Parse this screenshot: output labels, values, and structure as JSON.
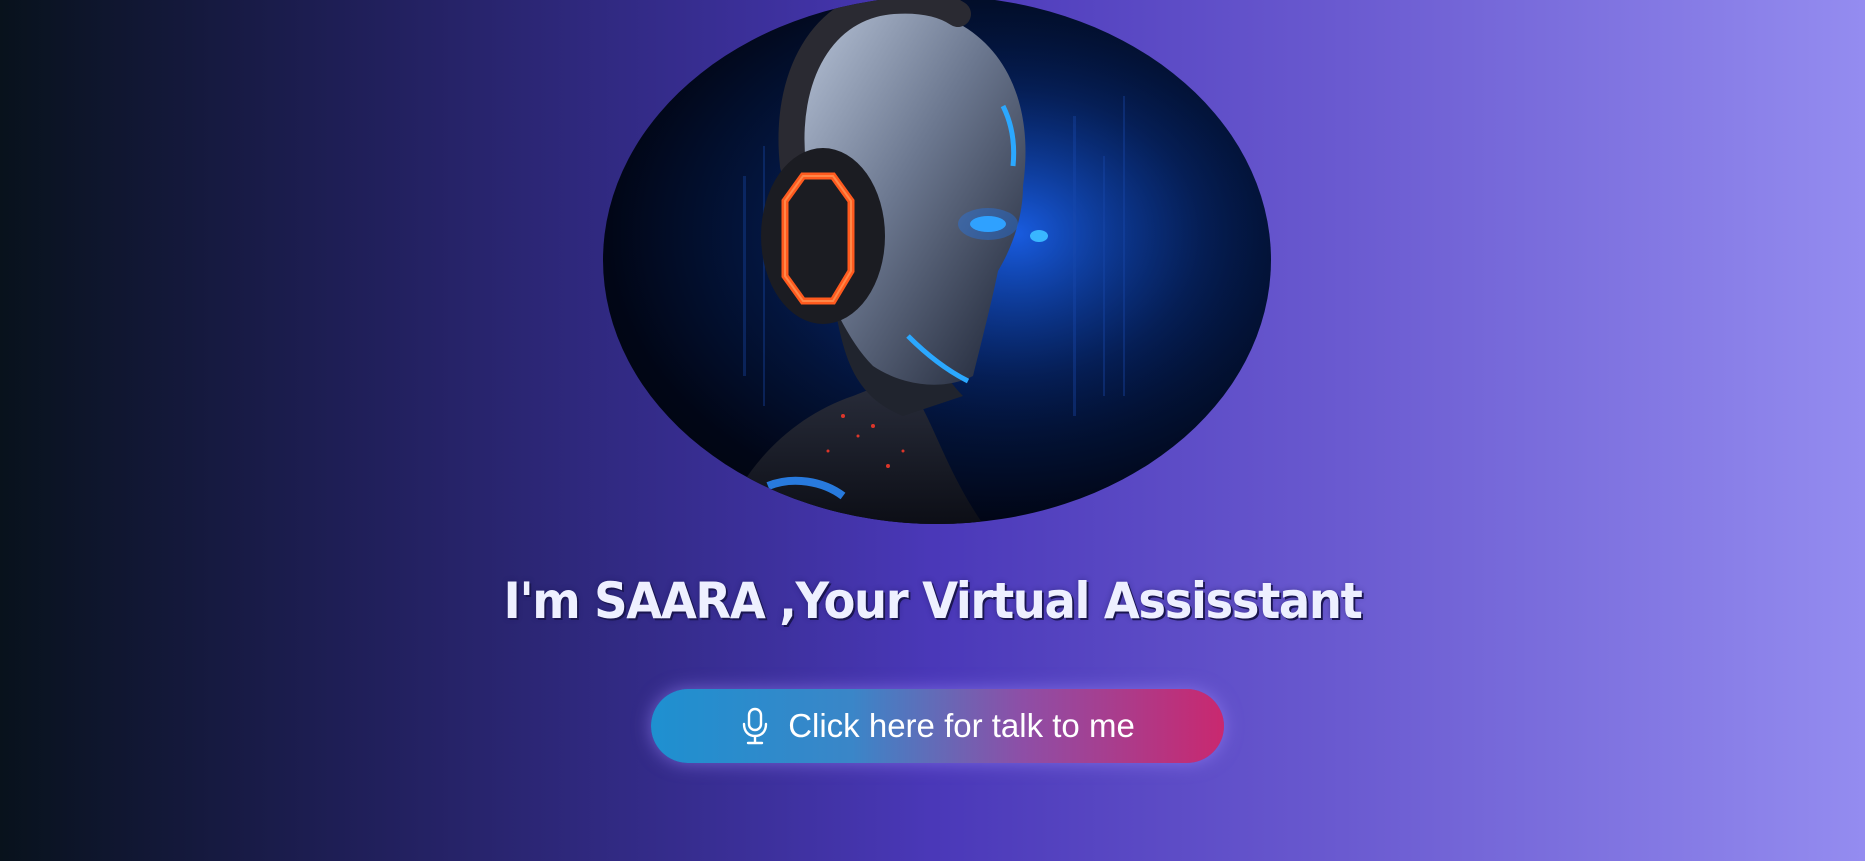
{
  "hero": {
    "image_icon": "robot-with-headphones-icon",
    "title": "I'm SAARA ,Your Virtual Assisstant"
  },
  "talk_button": {
    "icon": "microphone-icon",
    "label": "Click here for talk to me"
  }
}
